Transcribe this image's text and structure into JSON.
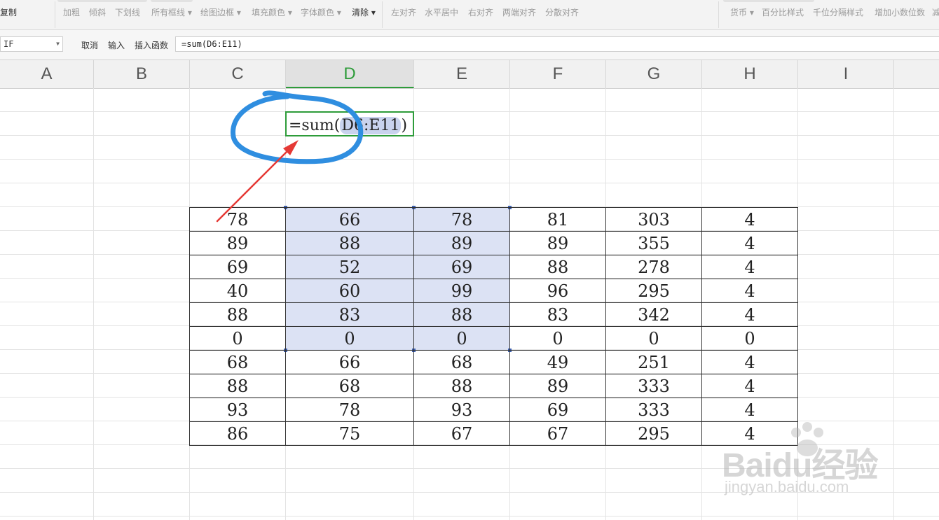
{
  "toolbar": {
    "left_label": "复制",
    "format_items": [
      "加粗",
      "倾斜",
      "下划线",
      "所有框线",
      "绘图边框",
      "填充颜色",
      "字体颜色",
      "清除"
    ],
    "align_items": [
      "左对齐",
      "水平居中",
      "右对齐",
      "两端对齐",
      "分散对齐"
    ],
    "number_items": [
      "货币",
      "百分比样式",
      "千位分隔样式",
      "增加小数位数",
      "减"
    ]
  },
  "formula_bar": {
    "name_box": "IF",
    "cancel_label": "取消",
    "enter_label": "输入",
    "insert_function_label": "插入函数",
    "formula": "=sum(D6:E11)"
  },
  "sheet": {
    "columns": [
      "A",
      "B",
      "C",
      "D",
      "E",
      "F",
      "G",
      "H",
      "I"
    ],
    "active_column": "D",
    "editing_cell": {
      "prefix": "=sum(",
      "range": "D6:E11",
      "suffix": ")"
    },
    "table_rows": [
      [
        "78",
        "66",
        "78",
        "81",
        "303",
        "4"
      ],
      [
        "89",
        "88",
        "89",
        "89",
        "355",
        "4"
      ],
      [
        "69",
        "52",
        "69",
        "88",
        "278",
        "4"
      ],
      [
        "40",
        "60",
        "99",
        "96",
        "295",
        "4"
      ],
      [
        "88",
        "83",
        "88",
        "83",
        "342",
        "4"
      ],
      [
        "0",
        "0",
        "0",
        "0",
        "0",
        "0"
      ],
      [
        "68",
        "66",
        "68",
        "49",
        "251",
        "4"
      ],
      [
        "88",
        "68",
        "88",
        "89",
        "333",
        "4"
      ],
      [
        "93",
        "78",
        "93",
        "69",
        "333",
        "4"
      ],
      [
        "86",
        "75",
        "67",
        "67",
        "295",
        "4"
      ]
    ]
  },
  "annotation_colors": {
    "circle": "#2f8ee0",
    "arrow": "#e53935"
  },
  "watermark": {
    "logo": "Baidu经验",
    "url": "jingyan.baidu.com"
  }
}
